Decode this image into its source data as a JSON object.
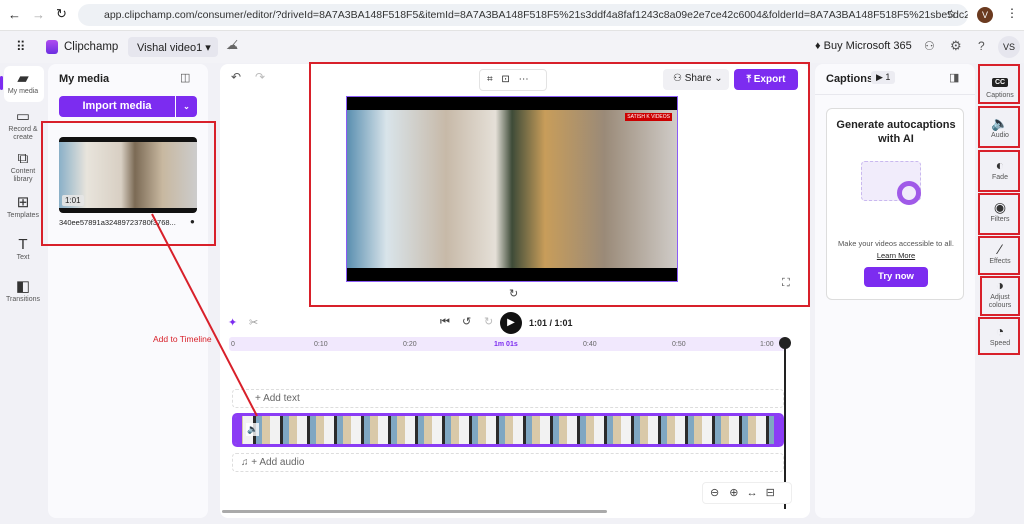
{
  "browser": {
    "url": "app.clipchamp.com/consumer/editor/?driveId=8A7A3BA148F518F5&itemId=8A7A3BA148F518F5%21s3ddf4a8faf1243c8a09e2e7ce42c6004&folderId=8A7A3BA148F518F5%21sbe5dc2d16d1a4c919645...",
    "profile": "V"
  },
  "app": {
    "name": "Clipchamp",
    "project": "Vishal video1",
    "buy": "Buy Microsoft 365",
    "avatar": "VS"
  },
  "left_rail": [
    {
      "label": "My media",
      "icon": "folder-icon"
    },
    {
      "label": "Record & create",
      "icon": "camera-icon"
    },
    {
      "label": "Content library",
      "icon": "library-icon"
    },
    {
      "label": "Templates",
      "icon": "templates-icon"
    },
    {
      "label": "Text",
      "icon": "text-icon"
    },
    {
      "label": "Transitions",
      "icon": "transitions-icon"
    }
  ],
  "media": {
    "title": "My media",
    "import": "Import media",
    "item": {
      "duration": "1:01",
      "name": "340ee57891a32489723780f3768..."
    }
  },
  "preview": {
    "share": "Share",
    "export": "Export",
    "watermark": "SATISH K VIDEOS"
  },
  "player": {
    "time": "1:01 / 1:01"
  },
  "timeline": {
    "ticks": [
      "0",
      "0:10",
      "0:20",
      "1m 01s",
      "0:40",
      "0:50",
      "1:00"
    ],
    "add_text": "+ Add text",
    "add_audio": "+ Add audio"
  },
  "annotation": {
    "label": "Add to Timeline"
  },
  "captions": {
    "title": "Captions",
    "count": "1",
    "heading": "Generate autocaptions with AI",
    "desc": "Make your videos accessible to all.",
    "learn": "Learn More",
    "try": "Try now"
  },
  "right_rail": [
    {
      "label": "Captions",
      "icon": "cc-icon"
    },
    {
      "label": "Audio",
      "icon": "speaker-icon"
    },
    {
      "label": "Fade",
      "icon": "fade-icon"
    },
    {
      "label": "Filters",
      "icon": "filters-icon"
    },
    {
      "label": "Effects",
      "icon": "wand-icon"
    },
    {
      "label": "Adjust colours",
      "icon": "contrast-icon"
    },
    {
      "label": "Speed",
      "icon": "speedometer-icon"
    }
  ],
  "colors": {
    "accent": "#7c2cf0",
    "annotation": "#d8202a"
  }
}
